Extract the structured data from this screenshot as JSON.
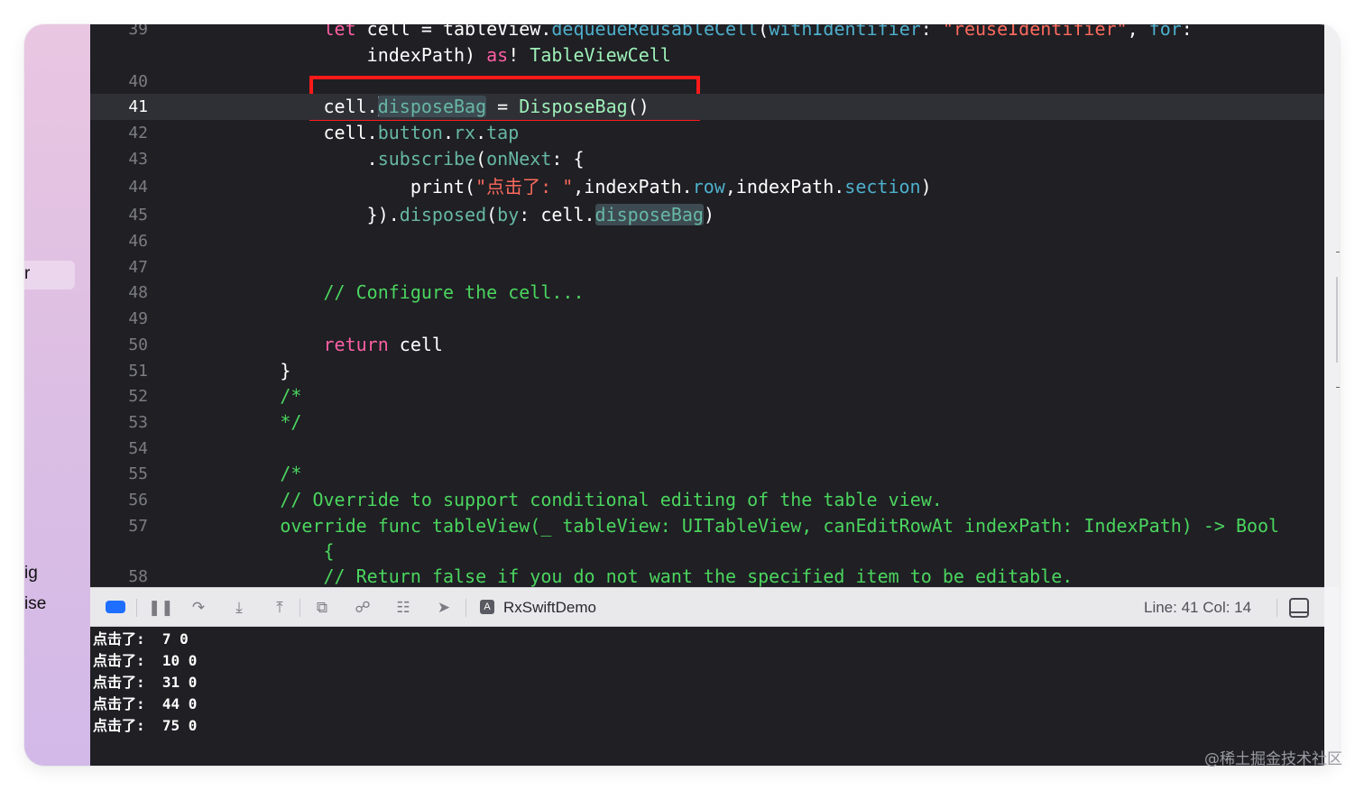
{
  "sidebar": {
    "fragments": [
      "r",
      "ig",
      "ise"
    ]
  },
  "editor": {
    "lines": [
      {
        "n": "39",
        "segs": [
          {
            "t": "            "
          },
          {
            "t": "let",
            "c": "k"
          },
          {
            "t": " cell = tableView."
          },
          {
            "t": "dequeueReusableCell",
            "c": "m"
          },
          {
            "t": "("
          },
          {
            "t": "withIdentifier",
            "c": "m"
          },
          {
            "t": ": "
          },
          {
            "t": "\"reuseIdentifier\"",
            "c": "s"
          },
          {
            "t": ", "
          },
          {
            "t": "for",
            "c": "m"
          },
          {
            "t": ":"
          }
        ]
      },
      {
        "n": "",
        "segs": [
          {
            "t": "                indexPath) "
          },
          {
            "t": "as",
            "c": "k"
          },
          {
            "t": "! "
          },
          {
            "t": "TableViewCell",
            "c": "t"
          }
        ]
      },
      {
        "n": "40",
        "segs": []
      },
      {
        "n": "41",
        "current": true,
        "segs": [
          {
            "t": "            cell."
          },
          {
            "caret": true
          },
          {
            "t": "disposeBag",
            "c": "p",
            "hl": true
          },
          {
            "t": " = "
          },
          {
            "t": "DisposeBag",
            "c": "t"
          },
          {
            "t": "()"
          }
        ]
      },
      {
        "n": "42",
        "segs": [
          {
            "t": "            cell."
          },
          {
            "t": "button",
            "c": "p"
          },
          {
            "t": "."
          },
          {
            "t": "rx",
            "c": "p"
          },
          {
            "t": "."
          },
          {
            "t": "tap",
            "c": "p"
          }
        ]
      },
      {
        "n": "43",
        "segs": [
          {
            "t": "                ."
          },
          {
            "t": "subscribe",
            "c": "p"
          },
          {
            "t": "("
          },
          {
            "t": "onNext",
            "c": "p"
          },
          {
            "t": ": {"
          }
        ]
      },
      {
        "n": "44",
        "segs": [
          {
            "t": "                    print("
          },
          {
            "t": "\"点击了: \"",
            "c": "s"
          },
          {
            "t": ",indexPath."
          },
          {
            "t": "row",
            "c": "m"
          },
          {
            "t": ",indexPath."
          },
          {
            "t": "section",
            "c": "m"
          },
          {
            "t": ")"
          }
        ]
      },
      {
        "n": "45",
        "segs": [
          {
            "t": "                })."
          },
          {
            "t": "disposed",
            "c": "p"
          },
          {
            "t": "("
          },
          {
            "t": "by",
            "c": "p"
          },
          {
            "t": ": cell."
          },
          {
            "t": "disposeBag",
            "c": "p",
            "hl": true
          },
          {
            "t": ")"
          }
        ]
      },
      {
        "n": "46",
        "segs": []
      },
      {
        "n": "47",
        "segs": []
      },
      {
        "n": "48",
        "segs": [
          {
            "t": "            "
          },
          {
            "t": "// Configure the cell...",
            "c": "c"
          }
        ]
      },
      {
        "n": "49",
        "segs": []
      },
      {
        "n": "50",
        "segs": [
          {
            "t": "            "
          },
          {
            "t": "return",
            "c": "k"
          },
          {
            "t": " cell"
          }
        ]
      },
      {
        "n": "51",
        "segs": [
          {
            "t": "        }"
          }
        ]
      },
      {
        "n": "52",
        "segs": [
          {
            "t": "        "
          },
          {
            "t": "/*",
            "c": "c"
          }
        ]
      },
      {
        "n": "53",
        "segs": [
          {
            "t": "        "
          },
          {
            "t": "*/",
            "c": "c"
          }
        ]
      },
      {
        "n": "54",
        "segs": []
      },
      {
        "n": "55",
        "segs": [
          {
            "t": "        "
          },
          {
            "t": "/*",
            "c": "c"
          }
        ]
      },
      {
        "n": "56",
        "segs": [
          {
            "t": "        "
          },
          {
            "t": "// Override to support conditional editing of the table view.",
            "c": "c"
          }
        ]
      },
      {
        "n": "57",
        "segs": [
          {
            "t": "        "
          },
          {
            "t": "override func tableView(_ tableView: UITableView, canEditRowAt indexPath: IndexPath) -> Bool",
            "c": "c"
          }
        ]
      },
      {
        "n": "",
        "segs": [
          {
            "t": "            "
          },
          {
            "t": "{",
            "c": "c"
          }
        ]
      },
      {
        "n": "58",
        "segs": [
          {
            "t": "            "
          },
          {
            "t": "// Return false if you do not want the specified item to be editable.",
            "c": "c"
          }
        ]
      }
    ]
  },
  "toolbar": {
    "scheme_name": "RxSwiftDemo",
    "line_col": "Line: 41  Col: 14"
  },
  "console": {
    "lines": [
      "点击了:  7 0",
      "点击了:  10 0",
      "点击了:  31 0",
      "点击了:  44 0",
      "点击了:  75 0"
    ]
  },
  "watermark": "@稀土掘金技术社区"
}
